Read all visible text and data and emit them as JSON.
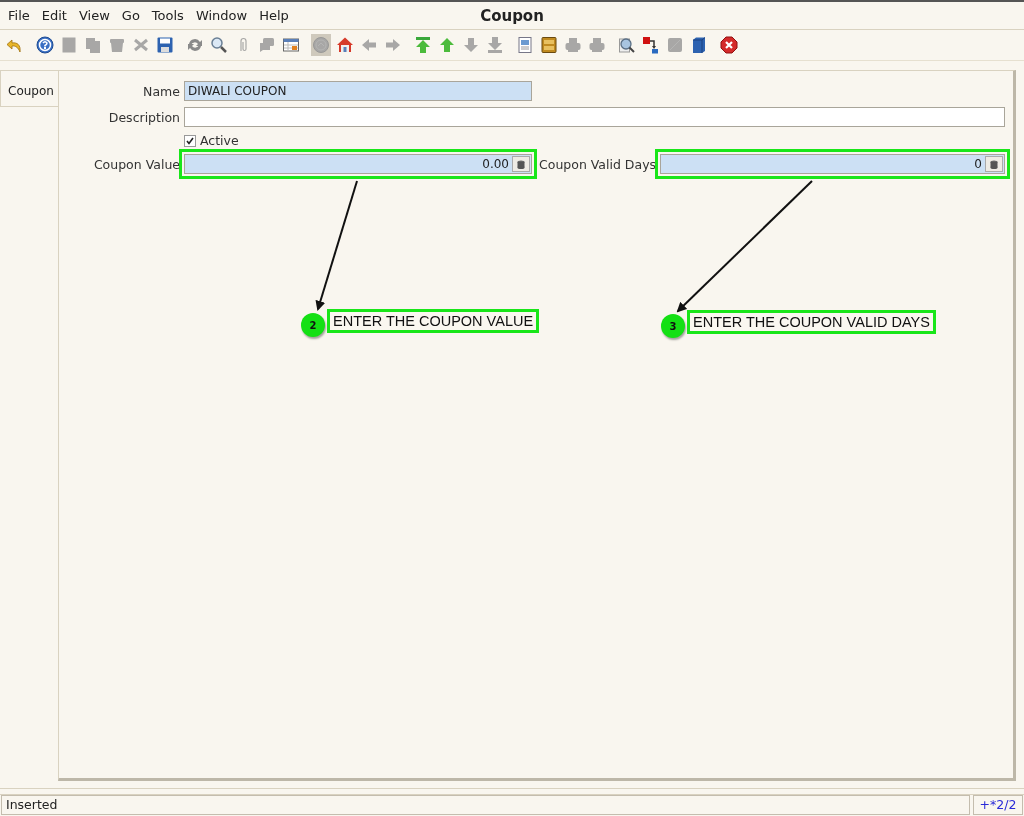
{
  "window": {
    "title": "Coupon"
  },
  "menu": [
    {
      "label": "File"
    },
    {
      "label": "Edit"
    },
    {
      "label": "View"
    },
    {
      "label": "Go"
    },
    {
      "label": "Tools"
    },
    {
      "label": "Window"
    },
    {
      "label": "Help"
    }
  ],
  "toolbar": [
    [
      {
        "kind": "undo",
        "disabled": false
      }
    ],
    [
      {
        "kind": "help",
        "disabled": false
      },
      {
        "kind": "new",
        "disabled": true
      },
      {
        "kind": "copy",
        "disabled": true
      },
      {
        "kind": "delete",
        "disabled": true
      },
      {
        "kind": "delete-selection",
        "disabled": true
      },
      {
        "kind": "save",
        "disabled": false
      }
    ],
    [
      {
        "kind": "refresh",
        "disabled": false
      },
      {
        "kind": "find",
        "disabled": false
      },
      {
        "kind": "attachment",
        "disabled": true
      },
      {
        "kind": "chat",
        "disabled": true
      },
      {
        "kind": "grid",
        "disabled": false
      }
    ],
    [
      {
        "kind": "history",
        "disabled": true,
        "selected": true
      },
      {
        "kind": "home",
        "disabled": false
      },
      {
        "kind": "previous",
        "disabled": true
      },
      {
        "kind": "next",
        "disabled": true
      }
    ],
    [
      {
        "kind": "first",
        "disabled": false
      },
      {
        "kind": "up",
        "disabled": false
      },
      {
        "kind": "down",
        "disabled": true
      },
      {
        "kind": "last",
        "disabled": true
      }
    ],
    [
      {
        "kind": "report",
        "disabled": false
      },
      {
        "kind": "archive",
        "disabled": false
      },
      {
        "kind": "print-preview",
        "disabled": true
      },
      {
        "kind": "print",
        "disabled": true
      }
    ],
    [
      {
        "kind": "zoom-across",
        "disabled": false
      },
      {
        "kind": "workflow",
        "disabled": false
      },
      {
        "kind": "request",
        "disabled": true
      },
      {
        "kind": "product",
        "disabled": false
      }
    ],
    [
      {
        "kind": "exit",
        "disabled": false
      }
    ]
  ],
  "tabs": [
    {
      "label": "Coupon",
      "selected": true
    }
  ],
  "form": {
    "name": {
      "label": "Name",
      "value": "DIWALI COUPON"
    },
    "description": {
      "label": "Description"
    },
    "active": {
      "label": "Active",
      "checked": true
    },
    "coupon_value": {
      "label": "Coupon Value",
      "value": "0.00",
      "highlighted": true
    },
    "coupon_valid_days": {
      "label": "Coupon Valid Days",
      "value": "0",
      "highlighted": true
    }
  },
  "annotations": [
    {
      "number": "2",
      "text": "ENTER THE COUPON VALUE"
    },
    {
      "number": "3",
      "text": "ENTER THE COUPON VALID DAYS"
    }
  ],
  "status_bar": {
    "message": "Inserted",
    "record": "+*2/2"
  }
}
